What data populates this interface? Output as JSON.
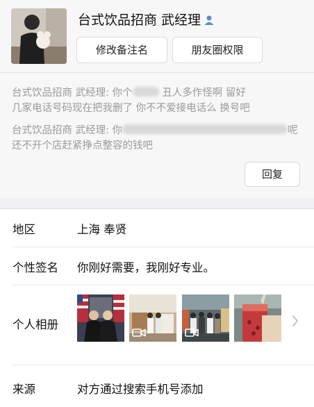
{
  "header": {
    "nickname": "台式饮品招商 武经理",
    "remark_button": "修改备注名",
    "moments_button": "朋友圈权限"
  },
  "messages": {
    "m1": {
      "part1": "台式饮品招商 武经理: 你个",
      "part2": " 丑人多作怪啊 留好",
      "line2": "几家电话号码现在把我删了 你不不爱接电话么 换号吧"
    },
    "m2": {
      "part1": "台式饮品招商 武经理: 你",
      "part2": "呢",
      "line2": "还不开个店赶紧挣点整容的钱吧"
    },
    "reply_button": "回复"
  },
  "profile": {
    "region_label": "地区",
    "region_value": "上海 奉贤",
    "signature_label": "个性签名",
    "signature_value": "你刚好需要，我刚好专业。",
    "album_label": "个人相册",
    "source_label": "来源",
    "source_value": "对方通过搜索手机号添加"
  },
  "icons": {
    "user_badge": "user-icon",
    "video": "video-icon",
    "chevron": "chevron-right-icon"
  },
  "colors": {
    "accent_badge": "#5b8ec6",
    "muted_text": "#9a9a9a"
  }
}
